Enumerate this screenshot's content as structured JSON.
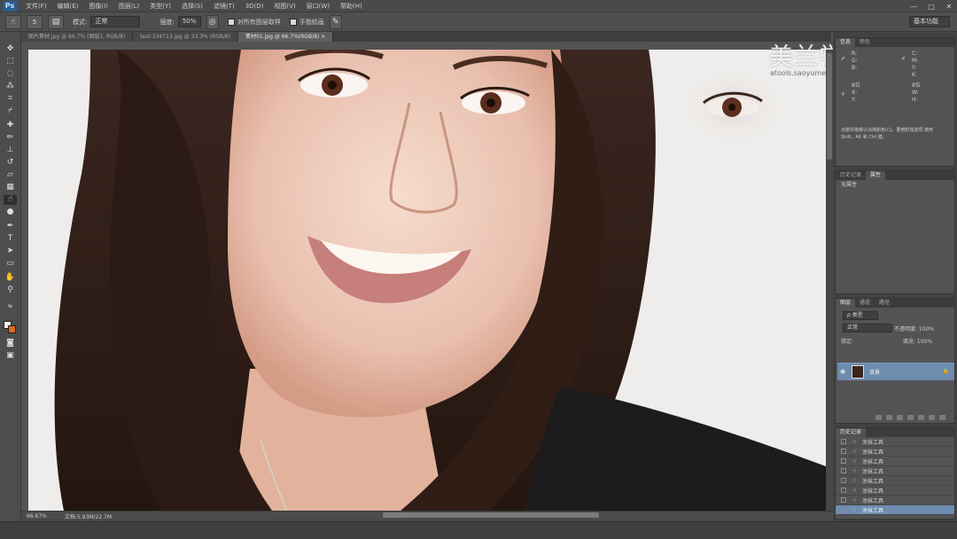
{
  "app": {
    "logo": "Ps"
  },
  "menu": [
    "文件(F)",
    "编辑(E)",
    "图像(I)",
    "图层(L)",
    "类型(Y)",
    "选择(S)",
    "滤镜(T)",
    "3D(D)",
    "视图(V)",
    "窗口(W)",
    "帮助(H)"
  ],
  "window_controls": {
    "minimize": "—",
    "maximize": "□",
    "close": "✕"
  },
  "options_bar": {
    "brush_size": "5",
    "mode_label": "模式:",
    "mode_value": "正常",
    "opacity_label": "强度:",
    "opacity_value": "50%",
    "sample_all_label": "对所有图层取样",
    "finger_label": "手指绘画",
    "workspace": "基本功能"
  },
  "doc_tabs": [
    {
      "title": "图片素材.jpg @ 66.7% (图层1, RGB/8)",
      "active": false
    },
    {
      "title": "test-334713.jpg @ 33.3% (RGB/8)",
      "active": false
    },
    {
      "title": "素材01.jpg @ 66.7%(RGB/8) ×",
      "active": true
    }
  ],
  "watermark": {
    "title": "美兰学院",
    "url": "atools.saoyumeilan.com"
  },
  "status": {
    "zoom": "66.67%",
    "doc": "文档:5.93M/22.7M"
  },
  "info_panel": {
    "tabs": [
      "信息",
      "颜色"
    ],
    "r": "R:",
    "g": "G:",
    "b": "B:",
    "c": "C:",
    "m": "M:",
    "y": "Y:",
    "k": "K:",
    "bits": "8位",
    "x": "X:",
    "y_coord": "Y:",
    "w": "W:",
    "h": "H:",
    "hint1": "点按并拖移以涂抹颜色(C)。要用附加选项,使用",
    "hint2": "Shift、Alt 和 Ctrl 键。"
  },
  "history_panel": {
    "tabs": [
      "历史记录",
      "属性"
    ],
    "items": [
      "无属性"
    ]
  },
  "layers_panel": {
    "tabs": [
      "图层",
      "通道",
      "路径"
    ],
    "kind": "ρ 类型",
    "blend": "正常",
    "opacity": "不透明度: 100%",
    "lock": "锁定:",
    "fill": "填充: 100%",
    "layer_name": "背景"
  },
  "actions_panel": {
    "tabs": [
      "历史记录"
    ],
    "items": [
      "涂抹工具",
      "涂抹工具",
      "涂抹工具",
      "涂抹工具",
      "涂抹工具",
      "涂抹工具",
      "涂抹工具",
      "涂抹工具"
    ]
  },
  "colors": {
    "accent_selection": "#6e8cae",
    "foreground": "#f4f1ea",
    "background": "#e06a1d"
  }
}
